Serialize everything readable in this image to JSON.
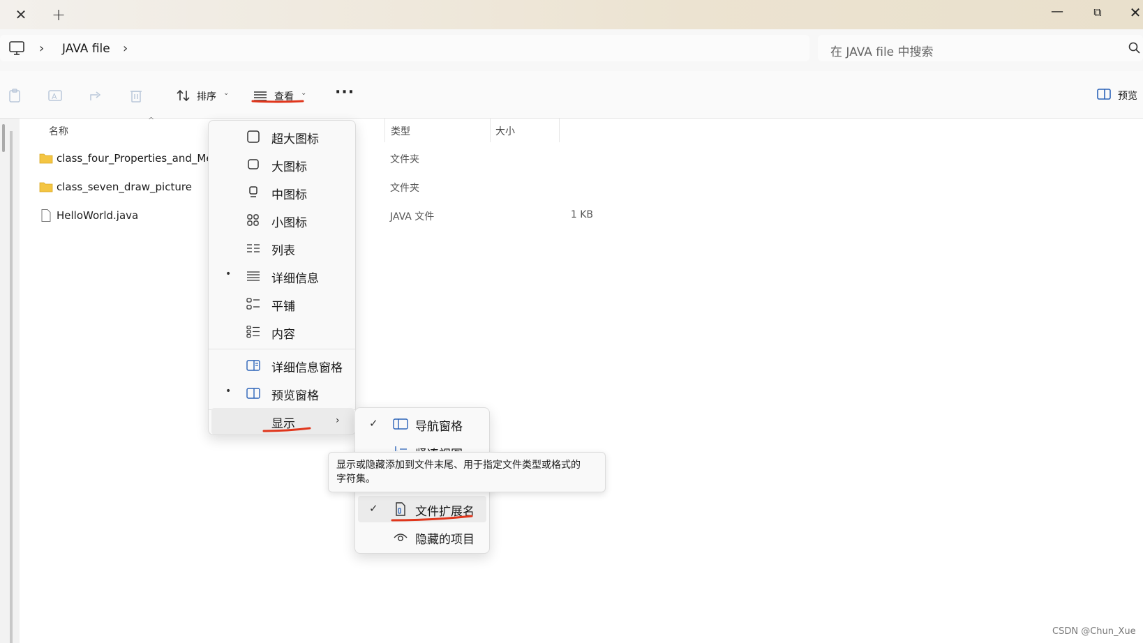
{
  "titlebar": {
    "close_tab_glyph": "✕",
    "new_tab_glyph": "+",
    "minimize_glyph": "—",
    "restore_glyph": "⧉",
    "close_window_glyph": "✕"
  },
  "address": {
    "breadcrumb": [
      "JAVA file"
    ],
    "chevron_glyph": "›",
    "search_placeholder": "在 JAVA file 中搜索"
  },
  "toolbar": {
    "sort_label": "排序",
    "view_label": "查看",
    "more_label": "···",
    "preview_label": "预览",
    "dropdown_glyph": "⌄"
  },
  "file_list": {
    "columns": {
      "name": "名称",
      "type": "类型",
      "size": "大小"
    },
    "sort_glyph": "^",
    "rows": [
      {
        "name": "class_four_Properties_and_Me",
        "type": "文件夹",
        "size": "",
        "icon": "folder-icon"
      },
      {
        "name": "class_seven_draw_picture",
        "type": "文件夹",
        "size": "",
        "icon": "folder-icon"
      },
      {
        "name": "HelloWorld.java",
        "type": "JAVA 文件",
        "size": "1 KB",
        "icon": "file-icon"
      }
    ]
  },
  "view_menu": {
    "items": [
      {
        "label": "超大图标",
        "icon": "extra-large-icons-icon",
        "selected": false
      },
      {
        "label": "大图标",
        "icon": "large-icons-icon",
        "selected": false
      },
      {
        "label": "中图标",
        "icon": "medium-icons-icon",
        "selected": false
      },
      {
        "label": "小图标",
        "icon": "small-icons-icon",
        "selected": false
      },
      {
        "label": "列表",
        "icon": "list-icon",
        "selected": false
      },
      {
        "label": "详细信息",
        "icon": "details-icon",
        "selected": true
      },
      {
        "label": "平铺",
        "icon": "tiles-icon",
        "selected": false
      },
      {
        "label": "内容",
        "icon": "content-icon",
        "selected": false
      },
      {
        "label": "详细信息窗格",
        "icon": "details-pane-icon",
        "selected": false
      },
      {
        "label": "预览窗格",
        "icon": "preview-pane-icon",
        "selected": true
      },
      {
        "label": "显示",
        "icon": "",
        "selected": false
      }
    ],
    "bullet_glyph": "•",
    "submenu_chevron": "›"
  },
  "show_submenu": {
    "items": [
      {
        "label": "导航窗格",
        "icon": "navigation-pane-icon",
        "checked": true
      },
      {
        "label": "紧凑视图",
        "icon": "compact-view-icon",
        "checked": false
      },
      {
        "label": "文件扩展名",
        "icon": "file-extension-icon",
        "checked": true
      },
      {
        "label": "隐藏的项目",
        "icon": "hidden-items-icon",
        "checked": false
      }
    ],
    "check_glyph": "✓"
  },
  "tooltip": {
    "line1": "显示或隐藏添加到文件末尾、用于指定文件类型或格式的",
    "line2": "字符集。"
  },
  "watermark": "CSDN @Chun_Xue",
  "colors": {
    "annotation_red": "#e0361c",
    "folder_yellow": "#f4c542",
    "hover_gray": "#ebebeb"
  }
}
